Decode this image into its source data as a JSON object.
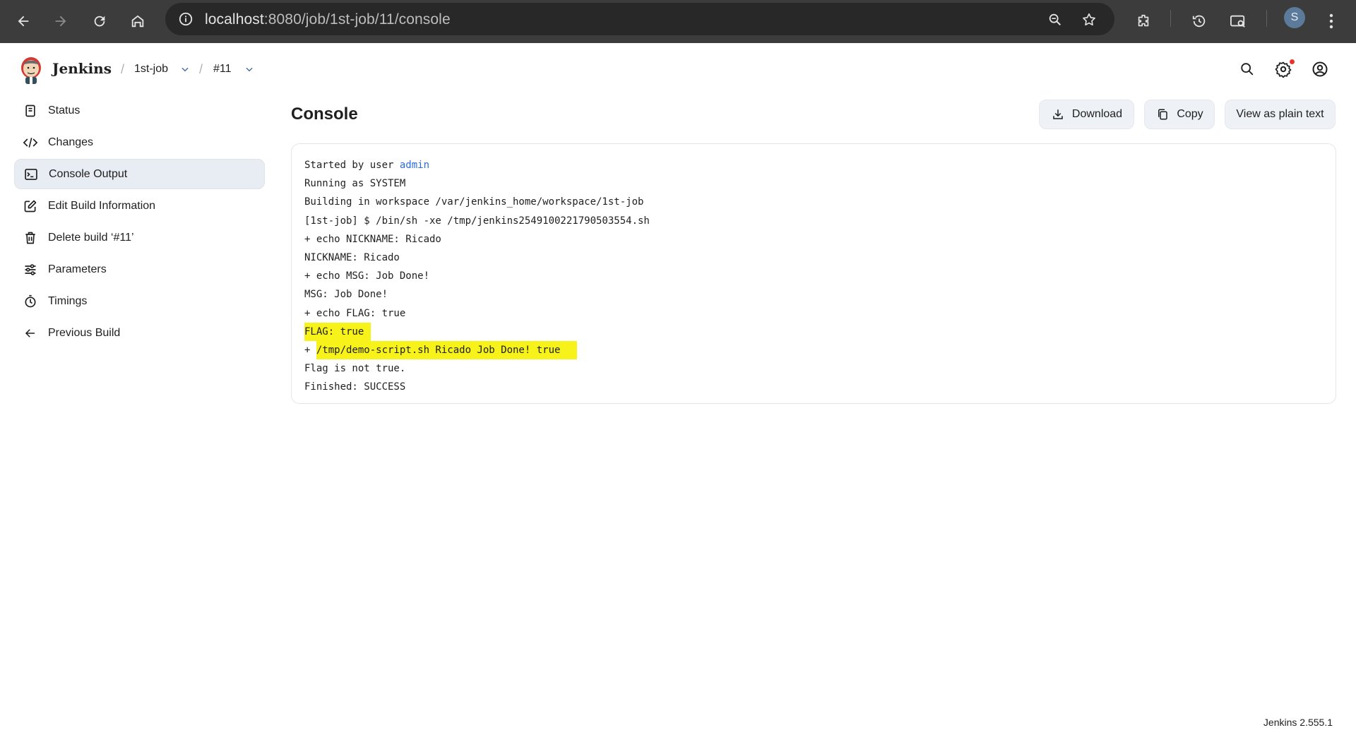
{
  "browser": {
    "url_host": "localhost",
    "url_path": ":8080/job/1st-job/11/console",
    "profile_initial": "S",
    "colors": {
      "chrome_bg": "#3c3c3c",
      "omnibox_bg": "#282828"
    }
  },
  "header": {
    "brand": "Jenkins",
    "breadcrumbs": [
      {
        "label": "1st-job"
      },
      {
        "label": "#11"
      }
    ],
    "icons": [
      "search-icon",
      "settings-icon",
      "account-icon"
    ]
  },
  "sidebar": {
    "items": [
      {
        "label": "Status",
        "icon": "status-icon",
        "active": false
      },
      {
        "label": "Changes",
        "icon": "code-icon",
        "active": false
      },
      {
        "label": "Console Output",
        "icon": "terminal-icon",
        "active": true
      },
      {
        "label": "Edit Build Information",
        "icon": "edit-icon",
        "active": false
      },
      {
        "label": "Delete build ‘#11’",
        "icon": "trash-icon",
        "active": false
      },
      {
        "label": "Parameters",
        "icon": "sliders-icon",
        "active": false
      },
      {
        "label": "Timings",
        "icon": "timer-icon",
        "active": false
      },
      {
        "label": "Previous Build",
        "icon": "arrow-left-icon",
        "active": false
      }
    ]
  },
  "main": {
    "title": "Console",
    "buttons": {
      "download": "Download",
      "copy": "Copy",
      "plain_text": "View as plain text"
    },
    "console": {
      "started_prefix": "Started by user ",
      "started_user": "admin",
      "lines": [
        "Running as SYSTEM",
        "Building in workspace /var/jenkins_home/workspace/1st-job",
        "[1st-job] $ /bin/sh -xe /tmp/jenkins2549100221790503554.sh",
        "+ echo NICKNAME: Ricado",
        "NICKNAME: Ricado",
        "+ echo MSG: Job Done!",
        "MSG: Job Done!",
        "+ echo FLAG: true"
      ],
      "highlighted_flag": "FLAG: true",
      "script_prefix": "+ ",
      "script_line": "/tmp/demo-script.sh Ricado Job Done! true",
      "tail_lines": [
        "Flag is not true.",
        "Finished: SUCCESS"
      ],
      "highlight_color": "#f7f21a"
    }
  },
  "footer": {
    "version": "Jenkins 2.555.1"
  }
}
